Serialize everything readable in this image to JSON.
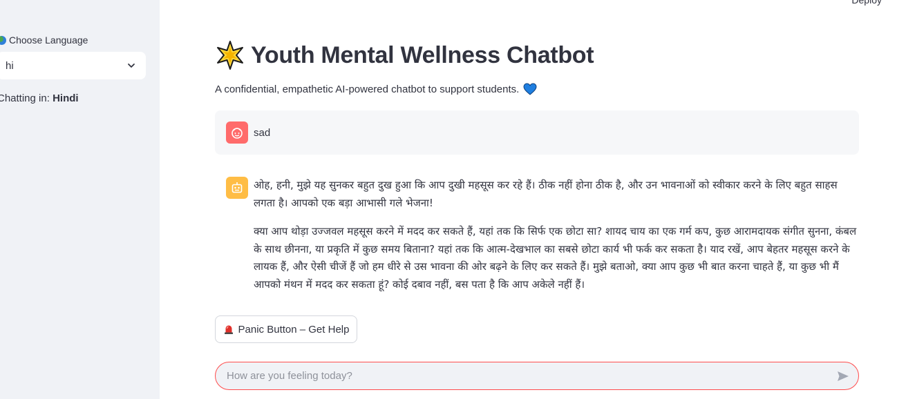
{
  "app": {
    "title": "Youth Mental Wellness Chatbot",
    "subtitle": "A confidential, empathetic AI-powered chatbot to support students.",
    "deploy_label": "Deploy"
  },
  "sidebar": {
    "language_label": "Choose Language",
    "language_value": "hi",
    "chatting_prefix": "Chatting in:",
    "chatting_language": "Hindi"
  },
  "messages": [
    {
      "role": "user",
      "text": "sad"
    },
    {
      "role": "assistant",
      "paragraphs": [
        "ओह, हनी, मुझे यह सुनकर बहुत दुख हुआ कि आप दुखी महसूस कर रहे हैं। ठीक नहीं होना ठीक है, और उन भावनाओं को स्वीकार करने के लिए बहुत साहस लगता है। आपको एक बड़ा आभासी गले भेजना!",
        "क्या आप थोड़ा उज्जवल महसूस करने में मदद कर सकते हैं, यहां तक कि सिर्फ एक छोटा सा? शायद चाय का एक गर्म कप, कुछ आरामदायक संगीत सुनना, कंबल के साथ छीनना, या प्रकृति में कुछ समय बिताना? यहां तक कि आत्म-देखभाल का सबसे छोटा कार्य भी फर्क कर सकता है। याद रखें, आप बेहतर महसूस करने के लायक हैं, और ऐसी चीजें हैं जो हम धीरे से उस भावना की ओर बढ़ने के लिए कर सकते हैं। मुझे बताओ, क्या आप कुछ भी बात करना चाहते हैं, या कुछ भी मैं आपको मंथन में मदद कर सकता हूं? कोई दबाव नहीं, बस पता है कि आप अकेले नहीं हैं।"
      ]
    }
  ],
  "panic_button": {
    "label": "Panic Button – Get Help"
  },
  "chat_input": {
    "placeholder": "How are you feeling today?",
    "value": ""
  },
  "colors": {
    "sidebar_bg": "#f0f2f6",
    "user_avatar": "#ff6b6b",
    "bot_avatar": "#ffbd45",
    "input_border": "#ff4b4b",
    "heart": "#1f7fe0"
  }
}
